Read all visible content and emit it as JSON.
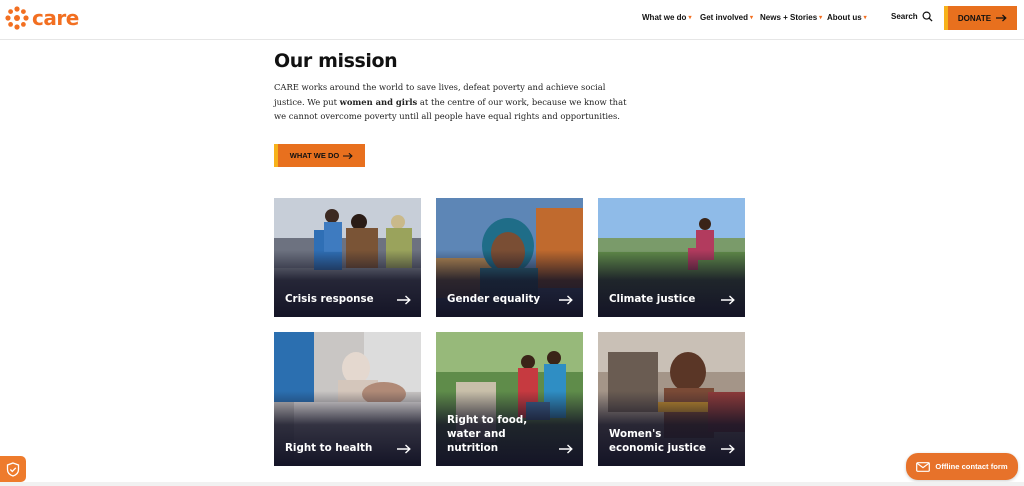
{
  "header": {
    "logo_text": "care",
    "nav": [
      {
        "label": "What we do"
      },
      {
        "label": "Get involved"
      },
      {
        "label": "News + Stories"
      },
      {
        "label": "About us"
      }
    ],
    "search_label": "Search",
    "donate_label": "DONATE"
  },
  "mission": {
    "title": "Our mission",
    "text_part1": "CARE works around the world to save lives, defeat poverty and achieve social justice. We put ",
    "text_bold": "women and girls",
    "text_part2": " at the centre of our work, because we know that we cannot overcome poverty until all people have equal rights and opportunities.",
    "cta_label": "WHAT WE DO"
  },
  "cards": [
    {
      "label": "Crisis response"
    },
    {
      "label": "Gender equality"
    },
    {
      "label": "Climate justice"
    },
    {
      "label": "Right to health"
    },
    {
      "label": "Right to food, water and nutrition"
    },
    {
      "label": "Women's economic justice"
    }
  ],
  "widgets": {
    "contact_label": "Offline contact form"
  },
  "colors": {
    "brand_orange": "#e8701e",
    "accent_yellow": "#f7b21b",
    "card_dark": "#1b1b2e"
  }
}
